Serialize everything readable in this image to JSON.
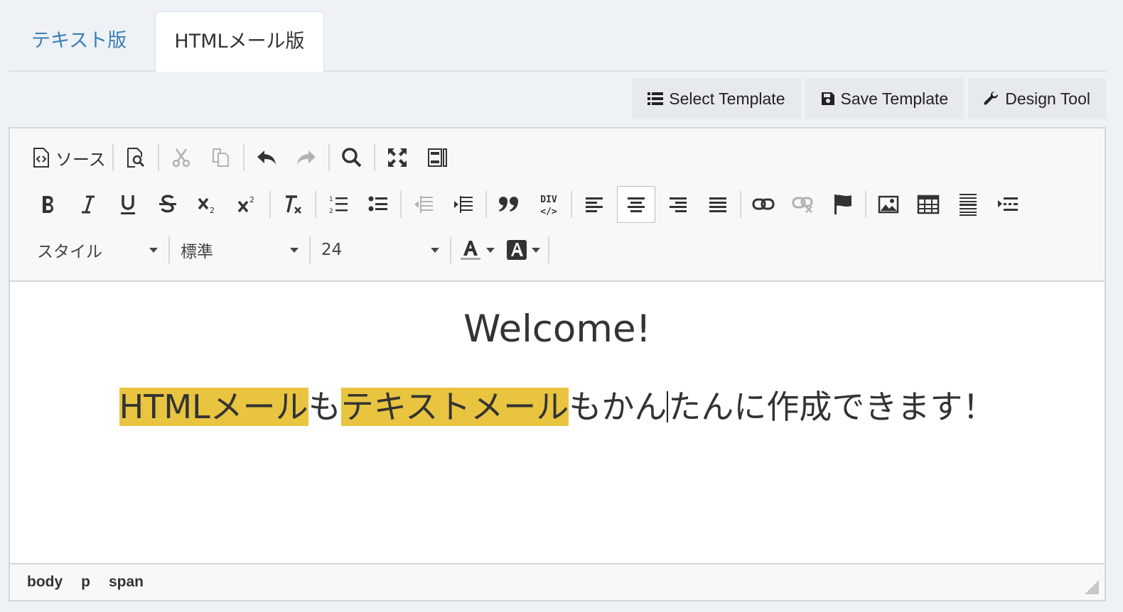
{
  "tabs": [
    {
      "label": "テキスト版",
      "active": false
    },
    {
      "label": "HTMLメール版",
      "active": true
    }
  ],
  "template_buttons": {
    "select": "Select Template",
    "save": "Save Template",
    "design": "Design Tool"
  },
  "toolbar": {
    "source_label": "ソース",
    "style_combo": "スタイル",
    "format_combo": "標準",
    "size_combo": "24",
    "div_label_top": "DIV",
    "div_label_bottom": "</>"
  },
  "content": {
    "heading": "Welcome!",
    "highlight1": "HTMLメール",
    "text1": "も",
    "highlight2": "テキストメール",
    "text2a": "もかん",
    "text2b": "たんに作成できます！"
  },
  "statusbar": {
    "crumbs": [
      "body",
      "p",
      "span"
    ]
  },
  "colors": {
    "highlight": "#e8c440",
    "tab_link": "#3a7fb5"
  }
}
